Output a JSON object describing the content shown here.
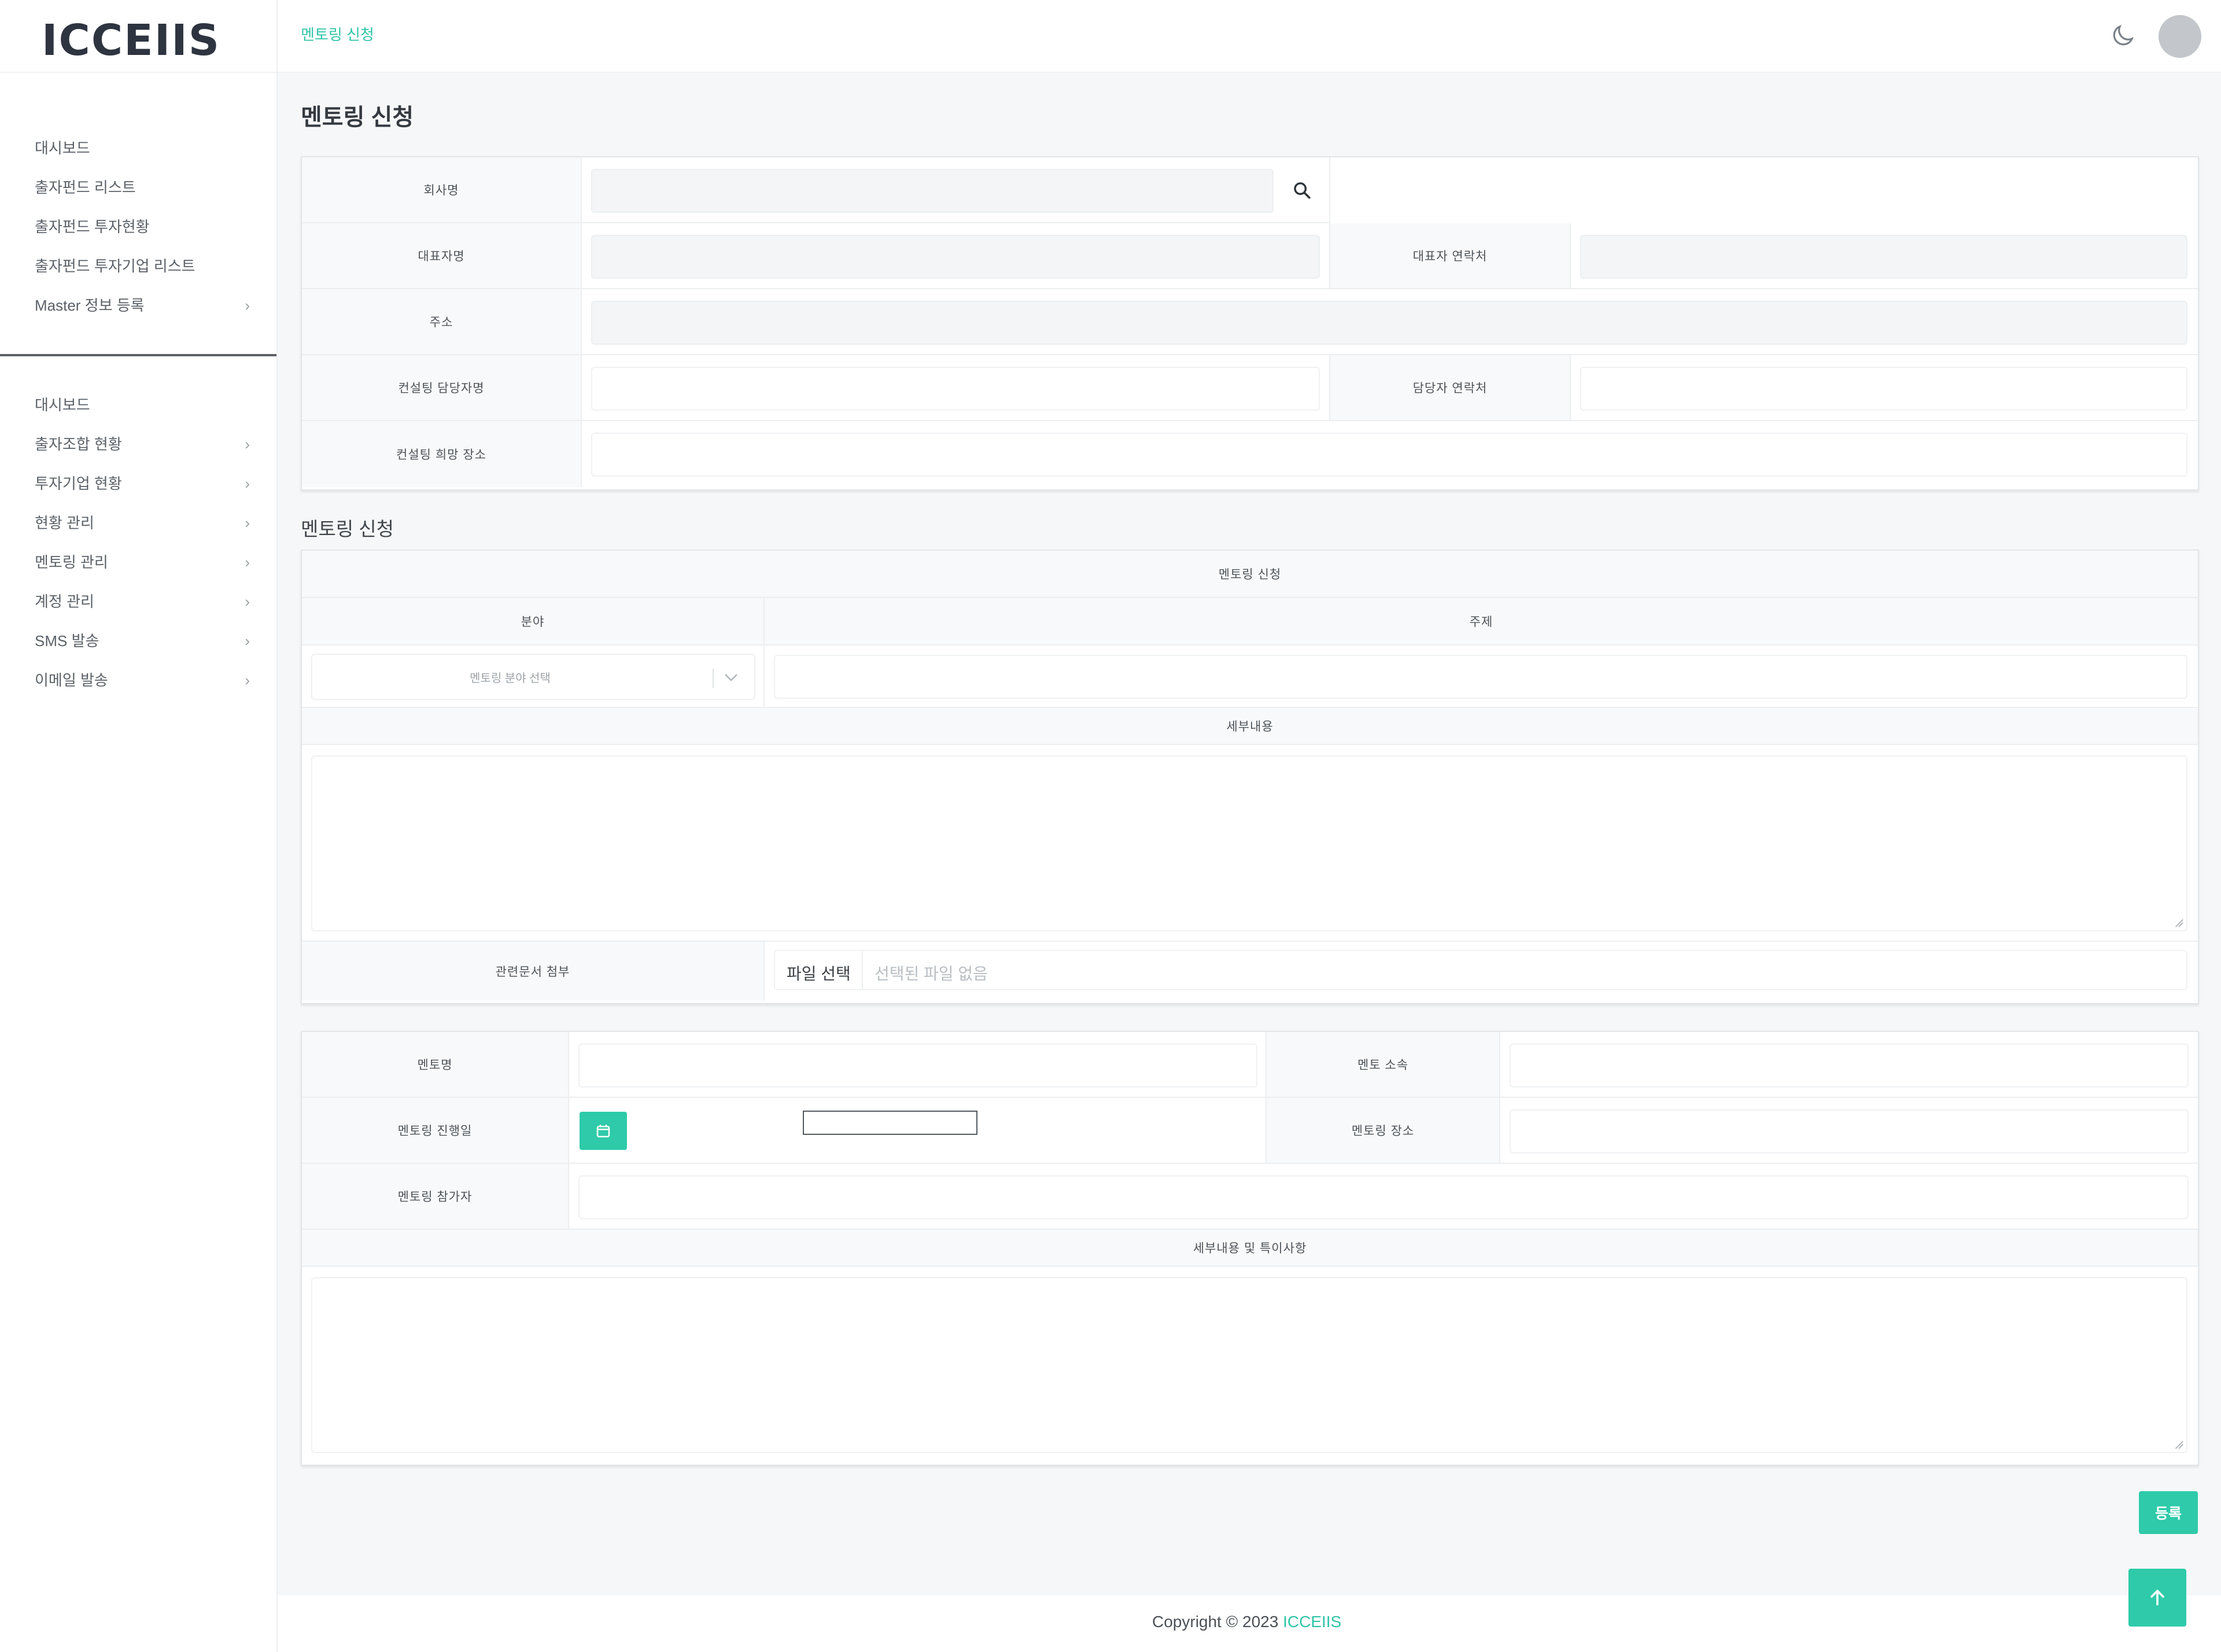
{
  "app": {
    "logo": "ICCEIIS"
  },
  "header": {
    "breadcrumb": "멘토링 신청"
  },
  "sidebar": {
    "group1": [
      {
        "label": "대시보드",
        "has_chevron": false
      },
      {
        "label": "출자펀드 리스트",
        "has_chevron": false
      },
      {
        "label": "출자펀드 투자현황",
        "has_chevron": false
      },
      {
        "label": "출자펀드 투자기업 리스트",
        "has_chevron": false
      },
      {
        "label": "Master 정보 등록",
        "has_chevron": true
      }
    ],
    "group2": [
      {
        "label": "대시보드",
        "has_chevron": false
      },
      {
        "label": "출자조합 현황",
        "has_chevron": true
      },
      {
        "label": "투자기업 현황",
        "has_chevron": true
      },
      {
        "label": "현황 관리",
        "has_chevron": true
      },
      {
        "label": "멘토링 관리",
        "has_chevron": true
      },
      {
        "label": "계정 관리",
        "has_chevron": true
      },
      {
        "label": "SMS 발송",
        "has_chevron": true
      },
      {
        "label": "이메일 발송",
        "has_chevron": true
      }
    ],
    "chevron": "›"
  },
  "page": {
    "title": "멘토링 신청",
    "company": {
      "company_name_label": "회사명",
      "ceo_name_label": "대표자명",
      "ceo_contact_label": "대표자 연락처",
      "address_label": "주소",
      "consulting_manager_label": "컨설팅 담당자명",
      "manager_contact_label": "담당자 연락처",
      "consulting_place_label": "컨설팅 희망 장소"
    },
    "application_section_title": "멘토링 신청",
    "application": {
      "header": "멘토링 신청",
      "field_label": "분야",
      "topic_label": "주제",
      "field_placeholder": "멘토링 분야 선택",
      "detail_label": "세부내용",
      "attachment_label": "관련문서 첨부",
      "file_button": "파일 선택",
      "file_none": "선택된 파일 없음"
    },
    "mentor": {
      "mentor_name_label": "멘토명",
      "mentor_affiliation_label": "멘토 소속",
      "mentoring_date_label": "멘토링 진행일",
      "mentoring_place_label": "멘토링 장소",
      "participants_label": "멘토링 참가자",
      "notes_label": "세부내용 및 특이사항"
    },
    "submit_label": "등록"
  },
  "footer": {
    "copyright": "Copyright © 2023",
    "brand": "ICCEIIS"
  },
  "colors": {
    "accent": "#2ecaa9",
    "text": "#3a3f45",
    "background": "#f6f7f8"
  }
}
